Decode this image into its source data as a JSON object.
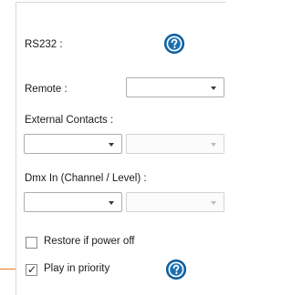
{
  "rs232": {
    "label": "RS232 :"
  },
  "remote": {
    "label": "Remote :",
    "value": ""
  },
  "external_contacts": {
    "label": "External Contacts :",
    "value_1": "",
    "value_2": ""
  },
  "dmx_in": {
    "label": "Dmx In (Channel / Level) :",
    "channel_value": "",
    "level_value": ""
  },
  "restore_if_power_off": {
    "label": "Restore if power off",
    "checked": false
  },
  "play_in_priority": {
    "label": "Play in priority",
    "checked": true,
    "check_glyph": "✓"
  },
  "icons": {
    "help": "help-question-icon",
    "dropdown": "chevron-down-icon"
  },
  "colors": {
    "help_icon": "#1b6fb0",
    "callout_line": "#e07a2a"
  }
}
